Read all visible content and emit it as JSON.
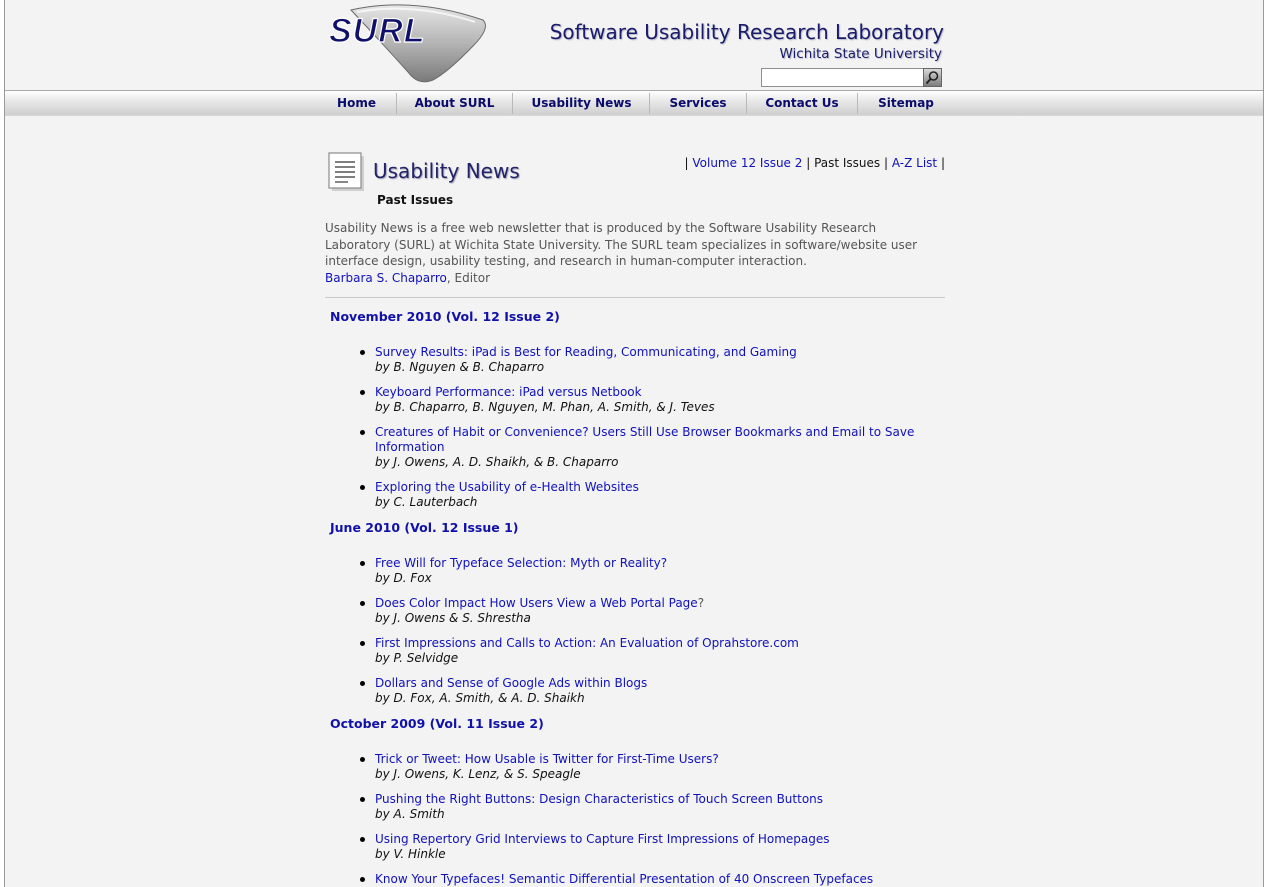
{
  "header": {
    "logo_text": "SURL",
    "lab_name": "Software Usability Research Laboratory",
    "university": "Wichita State University",
    "search_placeholder": ""
  },
  "nav": [
    "Home",
    "About SURL",
    "Usability News",
    "Services",
    "Contact Us",
    "Sitemap"
  ],
  "page": {
    "title": "Usability News",
    "subtitle": "Past Issues",
    "issue_links": {
      "current": "Volume 12 Issue 2",
      "past": "Past Issues",
      "az": "A-Z List"
    },
    "intro": "Usability News is a free web newsletter that is produced by the Software Usability Research Laboratory (SURL) at Wichita State University. The SURL team specializes in software/website user interface design, usability testing, and research in human-computer interaction.",
    "editor_name": "Barbara S. Chaparro",
    "editor_role": ", Editor"
  },
  "issues": [
    {
      "heading": "November 2010 (Vol. 12 Issue 2)",
      "articles": [
        {
          "title": "Survey Results: iPad is Best for Reading, Communicating, and Gaming",
          "suffix": "",
          "authors": "by B. Nguyen & B. Chaparro"
        },
        {
          "title": "Keyboard Performance: iPad versus Netbook",
          "suffix": "",
          "authors": "by B. Chaparro, B. Nguyen, M. Phan, A. Smith, & J. Teves"
        },
        {
          "title": "Creatures of Habit or Convenience? Users Still Use Browser Bookmarks and Email to Save Information",
          "suffix": "",
          "authors": "by J. Owens, A. D. Shaikh, & B. Chaparro"
        },
        {
          "title": "Exploring the Usability of e-Health Websites",
          "suffix": "",
          "authors": "by C. Lauterbach"
        }
      ]
    },
    {
      "heading": "June 2010 (Vol. 12 Issue 1)",
      "articles": [
        {
          "title": "Free Will for Typeface Selection: Myth or Reality?",
          "suffix": "",
          "authors": "by D. Fox"
        },
        {
          "title": "Does Color Impact How Users View a Web Portal Page",
          "suffix": "?",
          "authors": "by J. Owens & S. Shrestha"
        },
        {
          "title": "First Impressions and Calls to Action: An Evaluation of Oprahstore.com",
          "suffix": "",
          "authors": "by P. Selvidge"
        },
        {
          "title": "Dollars and Sense of Google Ads within Blogs",
          "suffix": "",
          "authors": "by D. Fox, A. Smith, & A. D. Shaikh"
        }
      ]
    },
    {
      "heading": "October 2009 (Vol. 11 Issue 2)",
      "articles": [
        {
          "title": "Trick or Tweet: How Usable is Twitter for First-Time Users?",
          "suffix": "",
          "authors": "by J. Owens, K. Lenz, & S. Speagle"
        },
        {
          "title": "Pushing the Right Buttons: Design Characteristics of Touch Screen Buttons",
          "suffix": "",
          "authors": "by A. Smith"
        },
        {
          "title": "Using Repertory Grid Interviews to Capture First Impressions of Homepages",
          "suffix": "",
          "authors": "by V. Hinkle"
        },
        {
          "title": "Know Your Typefaces! Semantic Differential Presentation of 40 Onscreen Typefaces",
          "suffix": "",
          "authors": ""
        }
      ]
    }
  ]
}
